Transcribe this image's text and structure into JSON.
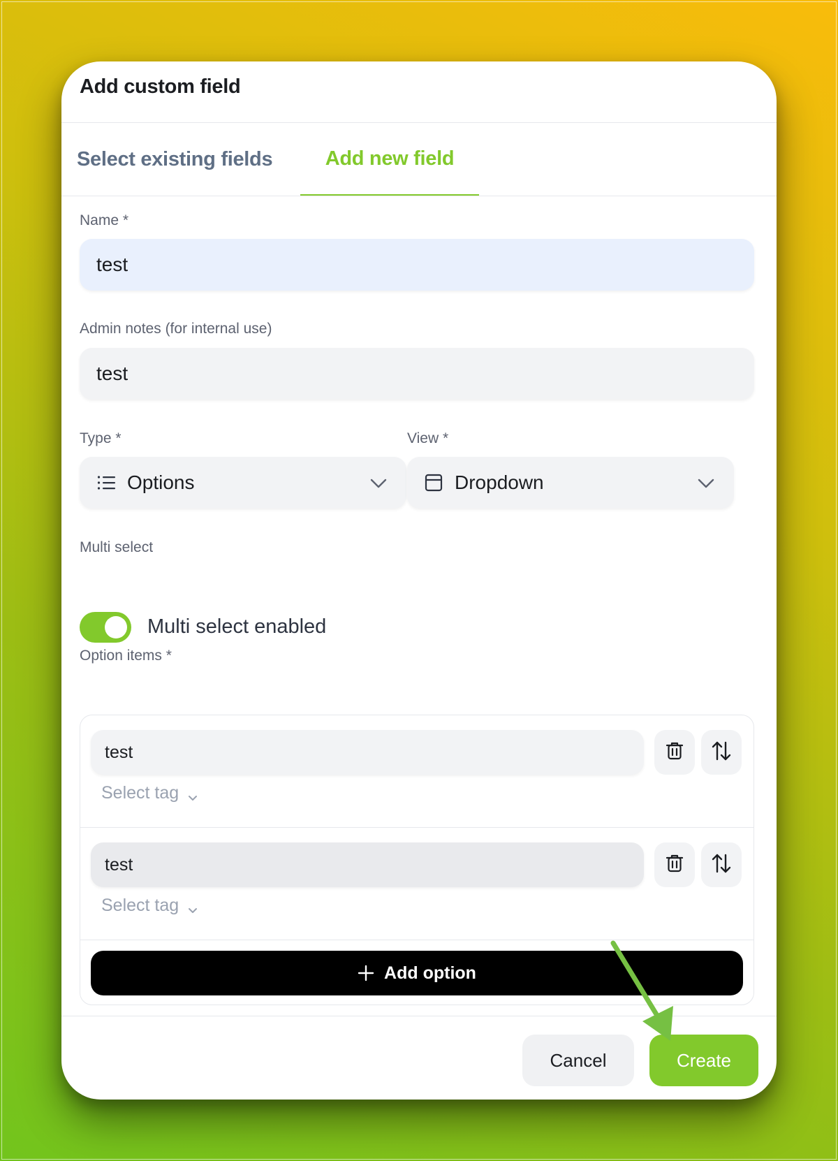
{
  "modal": {
    "title": "Add custom field",
    "tabs": [
      {
        "label": "Select existing fields",
        "active": false
      },
      {
        "label": "Add new field",
        "active": true
      }
    ]
  },
  "form": {
    "name": {
      "label": "Name *",
      "value": "test"
    },
    "admin_notes": {
      "label": "Admin notes (for internal use)",
      "value": "test"
    },
    "type": {
      "label": "Type *",
      "value": "Options",
      "icon": "list-icon"
    },
    "view": {
      "label": "View *",
      "value": "Dropdown",
      "icon": "window-icon"
    },
    "multi_select": {
      "label": "Multi select",
      "toggle_label": "Multi select enabled",
      "enabled": true
    },
    "option_items": {
      "label": "Option items *",
      "items": [
        {
          "value": "test",
          "tag_placeholder": "Select tag"
        },
        {
          "value": "test",
          "tag_placeholder": "Select tag"
        }
      ],
      "add_label": "Add option"
    }
  },
  "footer": {
    "cancel_label": "Cancel",
    "create_label": "Create"
  },
  "colors": {
    "accent": "#82c92c",
    "annotation_arrow": "#76c043"
  }
}
